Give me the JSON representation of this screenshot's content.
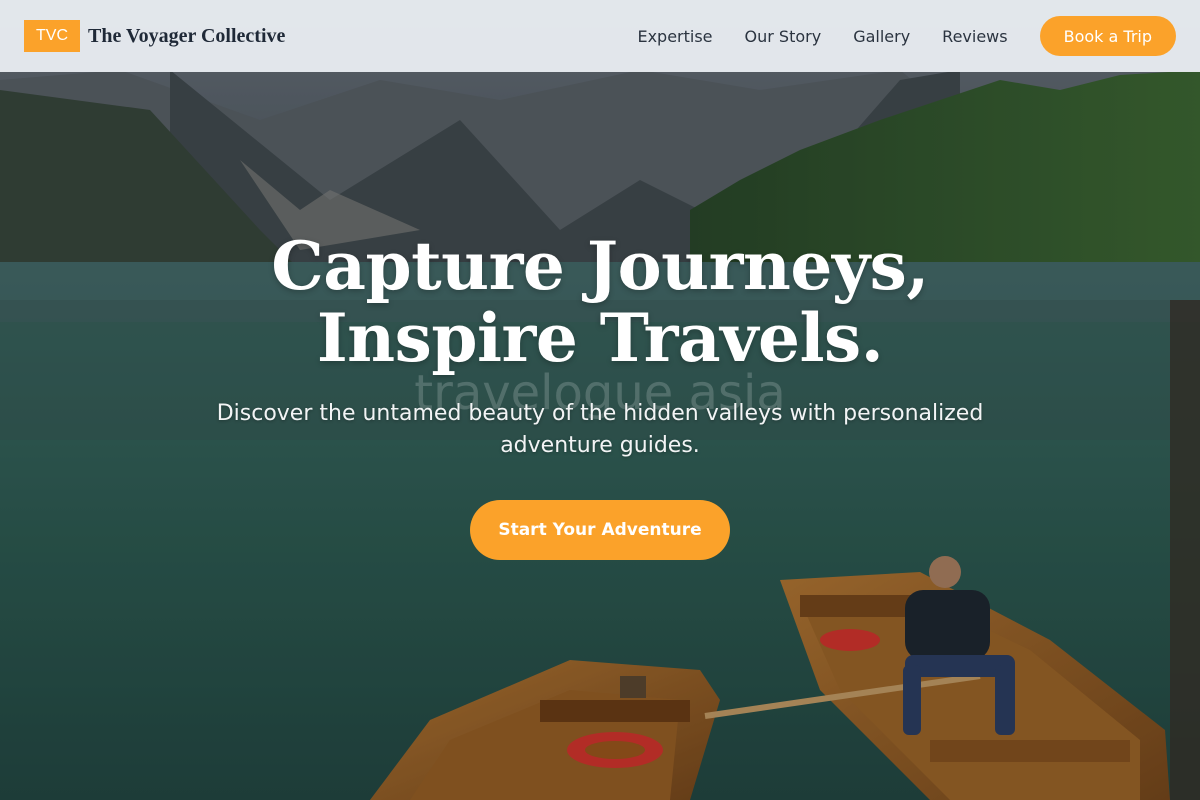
{
  "brand": {
    "badge": "TVC",
    "name": "The Voyager Collective"
  },
  "nav": {
    "links": [
      "Expertise",
      "Our Story",
      "Gallery",
      "Reviews"
    ],
    "cta": "Book a Trip"
  },
  "hero": {
    "title_line1": "Capture Journeys,",
    "title_line2": "Inspire Travels.",
    "subtitle": "Discover the untamed beauty of the hidden valleys with personalized adventure guides.",
    "cta": "Start Your Adventure",
    "watermark": "travelogue asia"
  },
  "colors": {
    "accent": "#fba22a",
    "nav_bg": "#e8ecf0",
    "lake": "#2f5a52"
  }
}
